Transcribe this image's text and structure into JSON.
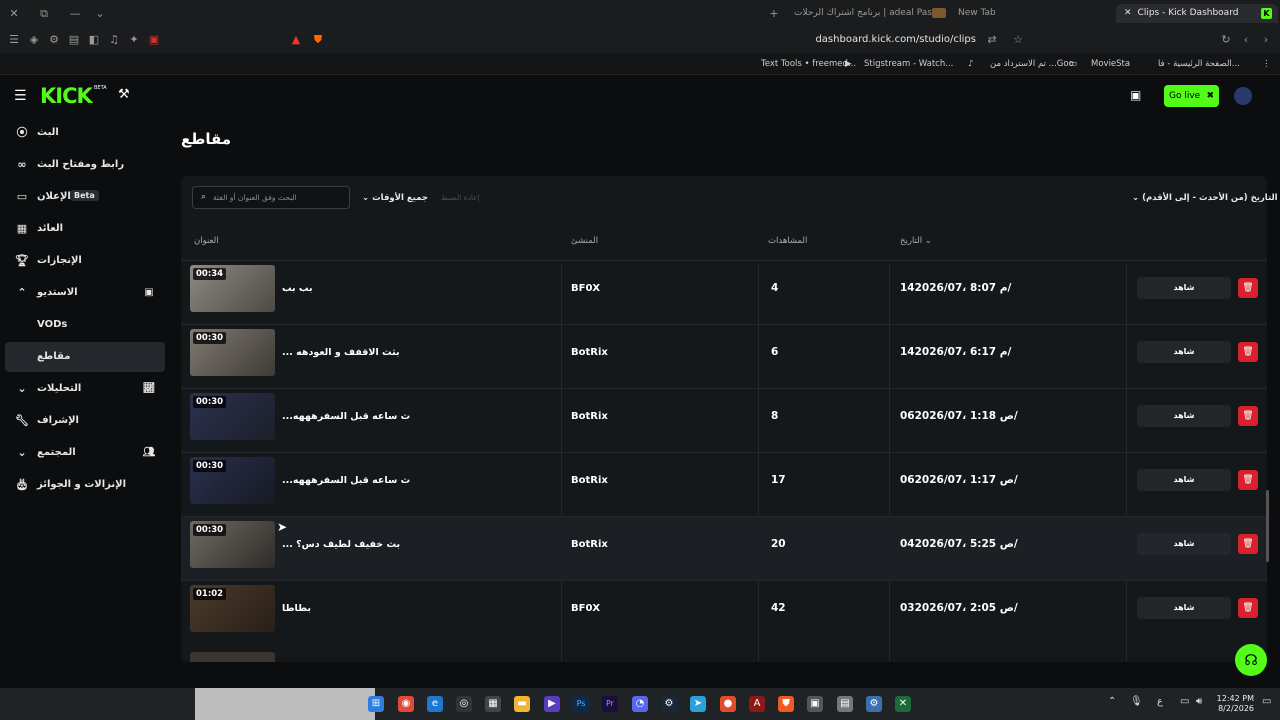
{
  "browser": {
    "tabs": [
      {
        "label": "Clips - Kick Dashboard",
        "active": true
      },
      {
        "label": "New Tab"
      },
      {
        "label": "برنامج اشتراك الرحلات | adeal Pass"
      }
    ],
    "url": "dashboard.kick.com/studio/clips",
    "bookmarks": [
      "Text Tools • freemed...",
      "Stigstream - Watch...",
      "تم الاسترداد من ...Goo",
      "MovieSta",
      "الصفحة الرئيسية - فا..."
    ]
  },
  "app": {
    "logo": "KICK",
    "logo_badge": "BETA",
    "go_live": "Go live",
    "page_title": "مقاطع",
    "sidebar": [
      {
        "label": "البث",
        "icon": "broadcast-icon"
      },
      {
        "label": "رابط ومفتاح البث",
        "icon": "link-icon"
      },
      {
        "label": "الإعلان",
        "badge": "Beta",
        "icon": "ad-icon"
      },
      {
        "label": "العائد",
        "icon": "revenue-icon"
      },
      {
        "label": "الإنجازات",
        "icon": "trophy-icon"
      },
      {
        "label": "الاستديو",
        "icon": "studio-icon"
      },
      {
        "label": "VODs"
      },
      {
        "label": "مقاطع"
      },
      {
        "label": "التحليلات",
        "icon": "analytics-icon"
      },
      {
        "label": "الإشراف",
        "icon": "moderation-icon"
      },
      {
        "label": "المجتمع",
        "icon": "community-icon"
      },
      {
        "label": "الإنزالات و الجوائز",
        "icon": "drops-icon"
      }
    ],
    "filters": {
      "search_placeholder": "البحث وفق العنوان أو الفئة",
      "time_filter": "جميع الأوقات",
      "reset": "إعادة الضبط",
      "sort": "التاريخ (من الأحدث - إلى الأقدم)"
    },
    "columns": {
      "title": "العنوان",
      "creator": "المنشئ",
      "views": "المشاهدات",
      "date": "التاريخ"
    },
    "watch_label": "شاهد",
    "clips": [
      {
        "duration": "00:34",
        "title": "بب بب",
        "creator": "BF0X",
        "views": "4",
        "date": "14م 8:07 ،2026/07/"
      },
      {
        "duration": "00:30",
        "title": "... بثث الاقفف و العودهه",
        "creator": "BotRix",
        "views": "6",
        "date": "14م 6:17 ،2026/07/"
      },
      {
        "duration": "00:30",
        "title": "...ث ساعه قبل السفرهههه",
        "creator": "BotRix",
        "views": "8",
        "date": "06ص 1:18 ،2026/07/"
      },
      {
        "duration": "00:30",
        "title": "...ث ساعه قبل السفرهههه",
        "creator": "BotRix",
        "views": "17",
        "date": "06ص 1:17 ،2026/07/"
      },
      {
        "duration": "00:30",
        "title": "... بث خفيف لطيف دس؟",
        "creator": "BotRix",
        "views": "20",
        "date": "04ص 5:25 ،2026/07/"
      },
      {
        "duration": "01:02",
        "title": "بطاطا",
        "creator": "BF0X",
        "views": "42",
        "date": "03ص 2:05 ،2026/07/"
      }
    ]
  },
  "taskbar": {
    "time": "12:42 PM",
    "date": "8/2/2026",
    "lang": "ع"
  }
}
